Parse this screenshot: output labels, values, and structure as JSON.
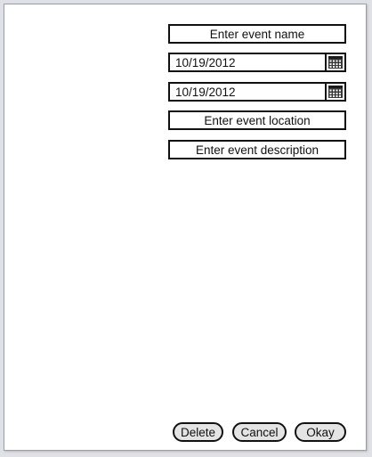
{
  "form": {
    "event_name": {
      "placeholder": "Enter event name"
    },
    "start_date": {
      "value": "10/19/2012",
      "icon": "calendar-icon"
    },
    "end_date": {
      "value": "10/19/2012",
      "icon": "calendar-icon"
    },
    "event_location": {
      "placeholder": "Enter event location"
    },
    "event_description": {
      "placeholder": "Enter event description"
    }
  },
  "actions": {
    "delete_label": "Delete",
    "cancel_label": "Cancel",
    "okay_label": "Okay"
  },
  "colors": {
    "border": "#111111",
    "button_fill": "#e4e4e4",
    "background": "#ffffff"
  }
}
